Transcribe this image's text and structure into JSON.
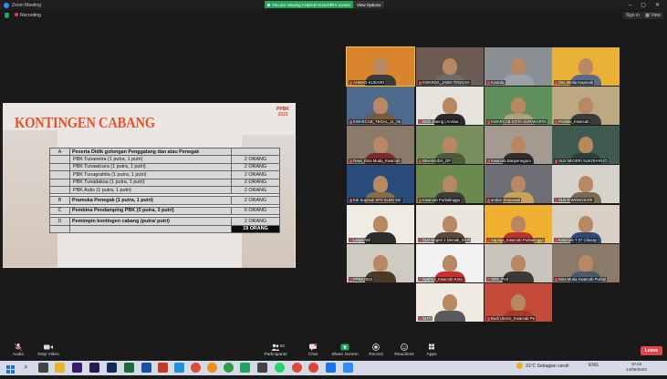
{
  "window": {
    "title": "Zoom Meeting",
    "sign_in": "Sign in",
    "view": "View",
    "recording": "Recording"
  },
  "banner": {
    "viewing": "You are viewing AHMAD KUSAIRI's screen",
    "view_options": "View Options"
  },
  "slide": {
    "title": "KONTINGEN CABANG",
    "logo_top": "PPBK",
    "logo_year": "2023",
    "rows": [
      {
        "letter": "A",
        "text": "Peserta Didik golongan Penggalang dan atau Penegak",
        "qty": "",
        "bold": true
      },
      {
        "letter": "",
        "text": "PBK Tunanetra (1 putra, 1 putri)",
        "qty": "2 ORANG",
        "bold": false
      },
      {
        "letter": "",
        "text": "PBK Tunawicara (1 putra, 1 putri)",
        "qty": "2 ORANG",
        "bold": false
      },
      {
        "letter": "",
        "text": "PBK Tunagrahita (1 putra, 1 putri)",
        "qty": "2 ORANG",
        "bold": false
      },
      {
        "letter": "",
        "text": "PBK Tunadaksa (1 putra, 1 putri)",
        "qty": "2 ORANG",
        "bold": false
      },
      {
        "letter": "",
        "text": "PBK Autis (1 putra, 1 putri)",
        "qty": "2 ORANG",
        "bold": false
      },
      {
        "letter": "B",
        "text": "Pramuka Penegak   (1 putra, 1 putri)",
        "qty": "2 ORANG",
        "bold": true
      },
      {
        "letter": "C",
        "text": "Pembina Pendamping PBK (3 putra, 3 putri)",
        "qty": "6 ORANG",
        "bold": true
      },
      {
        "letter": "D",
        "text": "Pemimpin kontingen cabang (putra/ putri)",
        "qty": "2 ORANG",
        "bold": true
      }
    ],
    "total": "19 ORANG"
  },
  "participants": [
    {
      "name": "AHMAD KUSAIRI",
      "bg": "#d9852e",
      "shirt": "#3a3a3a",
      "active": true
    },
    {
      "name": "KWARDA_JAWA TENGAH",
      "bg": "#6b5b52",
      "shirt": "#6d6d6d"
    },
    {
      "name": "Kwarda",
      "bg": "#8a8f93",
      "shirt": "#9aa0a6"
    },
    {
      "name": "Dita Meilia Kwarcab",
      "bg": "#e9b237",
      "shirt": "#5a6b85"
    },
    {
      "name": "KWARCAB_TEGAL_11_06",
      "bg": "#4d6a8c",
      "shirt": "#7a5a3a"
    },
    {
      "name": "DKD Jateng | Annisa",
      "bg": "#e6e2dc",
      "shirt": "#2a2a2a"
    },
    {
      "name": "KWARCAB KOTA SURAKARTA",
      "bg": "#5f8f5a",
      "shirt": "#b0a080"
    },
    {
      "name": "Pratikto_Kwarcab",
      "bg": "#bda981",
      "shirt": "#3b3b3b"
    },
    {
      "name": "Dewi_Bina Muda_Kwarcab",
      "bg": "#8b7a6a",
      "shirt": "#7a2a2a"
    },
    {
      "name": "BINAMUDA_DP",
      "bg": "#7a8f5e",
      "shirt": "#4a5a3a"
    },
    {
      "name": "Kwarcab Banjarnegara",
      "bg": "#a49a90",
      "shirt": "#2f2f2f"
    },
    {
      "name": "SLB NEGERI SUKOHARJO",
      "bg": "#3f5a4e",
      "shirt": "#2c3f3a"
    },
    {
      "name": "Edi Supriadi SPd SLBN Wir",
      "bg": "#2a4c7a",
      "shirt": "#8a6a4a"
    },
    {
      "name": "Kwarcab Purbalingga",
      "bg": "#6b8a4f",
      "shirt": "#3c3c3c"
    },
    {
      "name": "ambar Setyowati",
      "bg": "#6e6f74",
      "shirt": "#c8a25a"
    },
    {
      "name": "SLB N WONOSARI",
      "bg": "#d6d3cd",
      "shirt": "#7a6a52"
    },
    {
      "name": "Lanjar Wil",
      "bg": "#efece6",
      "shirt": "#2d2d2d"
    },
    {
      "name": "SLB Negeri 1 Demak_Sri R",
      "bg": "#ece7de",
      "shirt": "#5b4a3a"
    },
    {
      "name": "Saptaja_Kwarcab Purbalingga",
      "bg": "#f0b030",
      "shirt": "#c03030"
    },
    {
      "name": "Kwarcab T 07 Cilacap",
      "bg": "#d8d0c4",
      "shirt": "#2f4a78"
    },
    {
      "name": "PPBK2023",
      "bg": "#cfcac2",
      "shirt": "#4b3a2a"
    },
    {
      "name": "Syahrul_Kwarcab Kota",
      "bg": "#f2f2f2",
      "shirt": "#c9302c"
    },
    {
      "name": "SDS_Prof",
      "bg": "#c9c5bd",
      "shirt": "#3a3a3a"
    },
    {
      "name": "Bina Muda Kwarcab Purbal",
      "bg": "#8a7a6a",
      "shirt": "#4a5a6a"
    },
    {
      "name": "SUTI",
      "bg": "#efeae2",
      "shirt": "#5a5a5a"
    },
    {
      "name": "Budi Utomo_Kwarcab Pe",
      "bg": "#c44a3a",
      "shirt": "#a83a2a"
    }
  ],
  "toolbar": {
    "audio": "Audio",
    "stop_video": "Stop Video",
    "participants": "Participants",
    "participants_count": "62",
    "chat": "Chat",
    "share_screen": "Share Screen",
    "record": "Record",
    "reactions": "Reactions",
    "apps": "Apps",
    "leave": "Leave"
  },
  "taskbar": {
    "weather": "31°C  Sebagian cerah",
    "lang": "ENG",
    "time": "10:32",
    "date": "14/06/2023"
  },
  "colors": {
    "accent": "#2d8cff",
    "leave": "#e0454b",
    "share": "#23a55a",
    "slide_title": "#e8502a"
  }
}
